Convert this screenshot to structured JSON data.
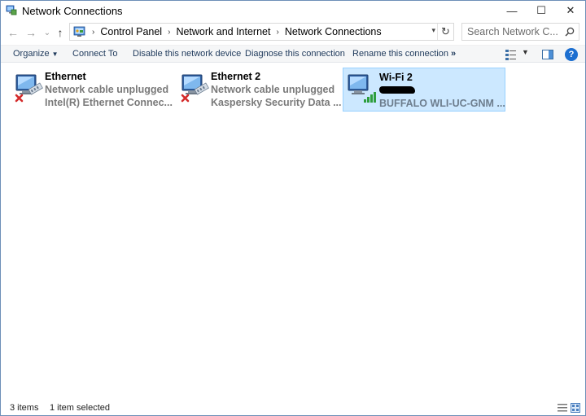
{
  "window": {
    "title": "Network Connections",
    "controls": {
      "minimize": "—",
      "maximize": "☐",
      "close": "✕"
    }
  },
  "nav": {
    "back": "←",
    "forward": "→",
    "recent": "⌄",
    "up": "↑",
    "breadcrumbs": [
      "Control Panel",
      "Network and Internet",
      "Network Connections"
    ],
    "separator": "›",
    "refresh": "↻",
    "search_placeholder": "Search Network C..."
  },
  "commands": {
    "organize": "Organize",
    "connect_to": "Connect To",
    "disable": "Disable this network device",
    "diagnose": "Diagnose this connection",
    "rename": "Rename this connection",
    "more": "»",
    "help": "?"
  },
  "items": [
    {
      "name": "Ethernet",
      "status": "Network cable unplugged",
      "device": "Intel(R) Ethernet Connec...",
      "type": "wired",
      "state": "disconnected",
      "selected": false
    },
    {
      "name": "Ethernet 2",
      "status": "Network cable unplugged",
      "device": "Kaspersky Security Data ...",
      "type": "wired",
      "state": "disconnected",
      "selected": false
    },
    {
      "name": "Wi-Fi 2",
      "status": "",
      "device": "BUFFALO WLI-UC-GNM ...",
      "type": "wireless",
      "state": "connected",
      "selected": true
    }
  ],
  "statusbar": {
    "count": "3 items",
    "selection": "1 item selected"
  },
  "colors": {
    "selection_bg": "#cce8ff",
    "selection_border": "#99d1ff",
    "command_text": "#1e395b",
    "disconnected_x": "#d42b2b",
    "signal_green": "#2e9e3e"
  }
}
